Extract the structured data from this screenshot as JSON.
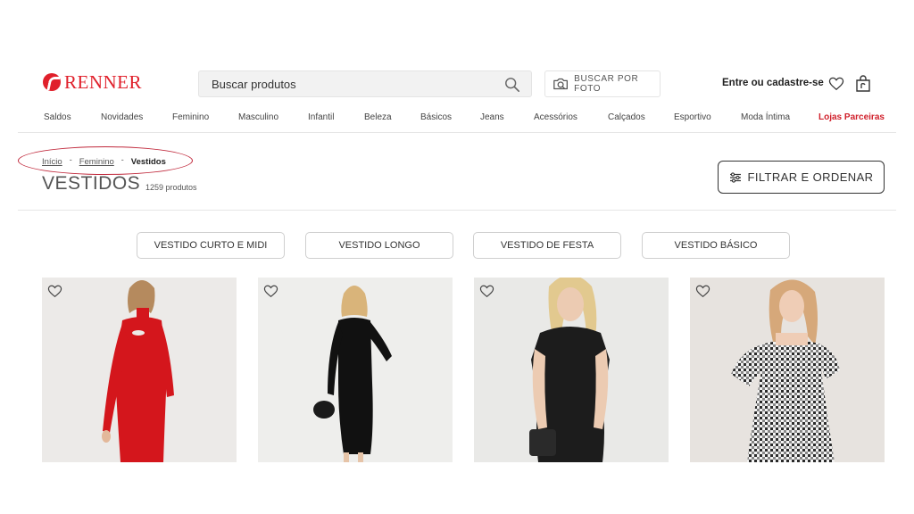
{
  "brand": {
    "name": "RENNER",
    "color": "#e0202b"
  },
  "search": {
    "placeholder": "Buscar produtos",
    "value": "",
    "icon": "search-icon"
  },
  "photo_search": {
    "label": "BUSCAR POR FOTO",
    "icon": "camera-icon"
  },
  "account": {
    "login_label": "Entre ou cadastre-se",
    "favorites_icon": "heart-icon",
    "bag_icon": "shopping-bag-icon"
  },
  "nav": {
    "items": [
      {
        "label": "Saldos"
      },
      {
        "label": "Novidades"
      },
      {
        "label": "Feminino"
      },
      {
        "label": "Masculino"
      },
      {
        "label": "Infantil"
      },
      {
        "label": "Beleza"
      },
      {
        "label": "Básicos"
      },
      {
        "label": "Jeans"
      },
      {
        "label": "Acessórios"
      },
      {
        "label": "Calçados"
      },
      {
        "label": "Esportivo"
      },
      {
        "label": "Moda Íntima"
      },
      {
        "label": "Lojas Parceiras",
        "highlight": true,
        "color": "#d0202b"
      }
    ]
  },
  "breadcrumb": {
    "items": [
      "Início",
      "Feminino"
    ],
    "separator": "-",
    "current": "Vestidos"
  },
  "page": {
    "title": "VESTIDOS",
    "count": "1259 produtos"
  },
  "filter": {
    "label": "FILTRAR E ORDENAR",
    "icon": "sliders-icon"
  },
  "chips": [
    {
      "label": "VESTIDO CURTO E MIDI"
    },
    {
      "label": "VESTIDO LONGO"
    },
    {
      "label": "VESTIDO DE FESTA"
    },
    {
      "label": "VESTIDO BÁSICO"
    }
  ],
  "products": [
    {
      "image": "red knit dress with cut-out neckline",
      "dress_color": "#d4161c"
    },
    {
      "image": "black long-sleeve midi dress with handbag",
      "dress_color": "#111111"
    },
    {
      "image": "black faux-leather sleeveless dress",
      "dress_color": "#1c1c1c"
    },
    {
      "image": "black and white gingham puff-sleeve dress",
      "dress_color": "#7a7a7a"
    }
  ]
}
